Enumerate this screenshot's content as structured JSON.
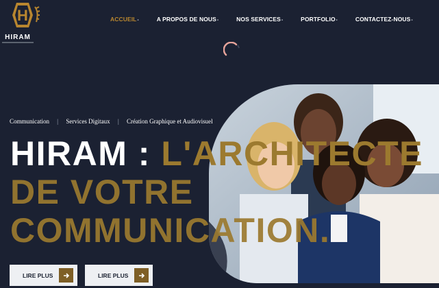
{
  "brand": {
    "name": "HIRAM",
    "monogram": "H",
    "gold": "#b8862f",
    "navy": "#1b2132",
    "icon": "laurel-hexagon-logo-icon"
  },
  "nav": {
    "items": [
      {
        "label": "ACCUEIL",
        "active": true
      },
      {
        "label": "A PROPOS DE NOUS",
        "active": false
      },
      {
        "label": "NOS SERVICES",
        "active": false
      },
      {
        "label": "PORTFOLIO",
        "active": false
      },
      {
        "label": "CONTACTEZ-NOUS",
        "active": false
      }
    ],
    "dot": "•"
  },
  "loader": {
    "icon": "spinner-icon"
  },
  "hero": {
    "tags": [
      "Communication",
      "Services Digitaux",
      "Création Graphique et Audiovisuel"
    ],
    "tag_separator": "|",
    "headline_part1": "HIRAM : ",
    "headline_part2": "L'ARCHITECTE",
    "headline_line2": "DE VOTRE",
    "headline_line3": "COMMUNICATION.",
    "image": "team-photo"
  },
  "buttons": [
    {
      "label": "LIRE PLUS",
      "icon": "arrow-right-icon"
    },
    {
      "label": "LIRE PLUS",
      "icon": "arrow-right-icon"
    }
  ]
}
